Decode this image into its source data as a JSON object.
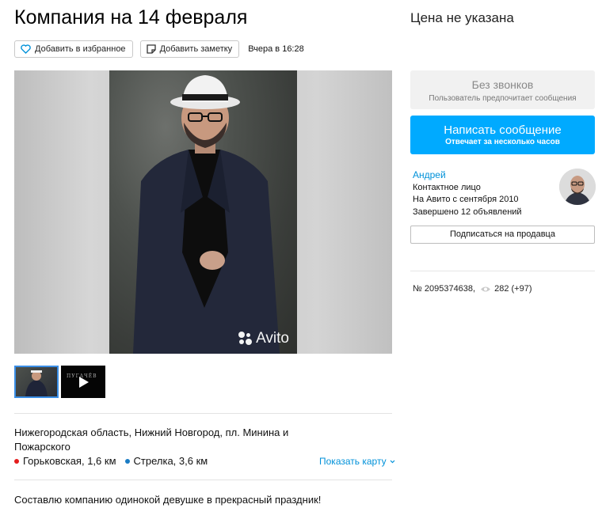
{
  "title": "Компания на 14 февраля",
  "price": "Цена не указана",
  "actions": {
    "favorite_label": "Добавить в избранное",
    "note_label": "Добавить заметку",
    "date": "Вчера в 16:28"
  },
  "photo": {
    "watermark": "Avito"
  },
  "thumbnails": [
    {
      "kind": "photo"
    },
    {
      "kind": "video",
      "text": "ПУГАЧЁВ"
    }
  ],
  "location": {
    "address": "Нижегородская область, Нижний Новгород, пл. Минина и Пожарского",
    "metro": [
      {
        "name": "Горьковская, 1,6 км",
        "color": "#e41c1c"
      },
      {
        "name": "Стрелка, 3,6 км",
        "color": "#1a7cc4"
      }
    ],
    "show_map": "Показать карту"
  },
  "description": "Составлю компанию одинокой девушке в прекрасный праздник!",
  "contact": {
    "no_calls_title": "Без звонков",
    "no_calls_sub": "Пользователь предпочитает сообщения",
    "write_title": "Написать сообщение",
    "write_sub": "Отвечает за несколько часов"
  },
  "seller": {
    "name": "Андрей",
    "role": "Контактное лицо",
    "since": "На Авито с сентября 2010",
    "completed": "Завершено 12 объявлений",
    "subscribe": "Подписаться на продавца"
  },
  "stats": {
    "ad_number": "№ 2095374638,",
    "views": "282 (+97)"
  },
  "colors": {
    "accent": "#00aaff",
    "link": "#0091d9"
  }
}
